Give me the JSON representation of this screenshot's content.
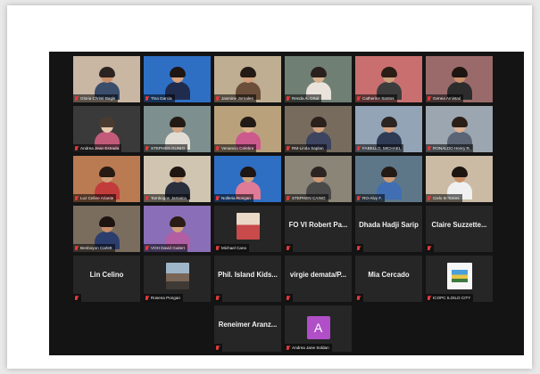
{
  "meeting": {
    "participants": [
      {
        "name": "Gloria Christi Bagis",
        "bg": "#c9b6a3",
        "skin": "#c98f6b",
        "hair": "#2b2320",
        "shirt": "#3a4d6b"
      },
      {
        "name": "Tina Garcia",
        "bg": "#2e6fc4",
        "skin": "#d9a37e",
        "hair": "#1d1613",
        "shirt": "#1f2c4e"
      },
      {
        "name": "Jasmine Jornales",
        "bg": "#bfae92",
        "skin": "#d2a07a",
        "hair": "#241a15",
        "shirt": "#6b4f3b"
      },
      {
        "name": "Renda A. Ortal",
        "bg": "#6f7f73",
        "skin": "#d8b18f",
        "hair": "#2a201b",
        "shirt": "#e9e3dc"
      },
      {
        "name": "Catherine Santos",
        "bg": "#c96f6f",
        "skin": "#caa07d",
        "hair": "#2a1d16",
        "shirt": "#3c3c3c"
      },
      {
        "name": "Genea Amistad",
        "bg": "#9a6a6a",
        "skin": "#c88f6a",
        "hair": "#1e1510",
        "shirt": "#2c2c2c"
      },
      {
        "name": "Andrea Jean Estrada",
        "bg": "#3a3a3a",
        "skin": "#e6c8ae",
        "hair": "#4a3b30",
        "shirt": "#c25b7a"
      },
      {
        "name": "STEPHEN GUNIO",
        "bg": "#7d8f8e",
        "skin": "#d4a583",
        "hair": "#231a14",
        "shirt": "#e1dcd3"
      },
      {
        "name": "Venancio Celebre",
        "bg": "#b9a27b",
        "skin": "#d8b08b",
        "hair": "#221a14",
        "shirt": "#cd5a8d"
      },
      {
        "name": "RM-Linda Saplan",
        "bg": "#766b5d",
        "skin": "#cfa17e",
        "hair": "#2b201a",
        "shirt": "#3d4460"
      },
      {
        "name": "FABELLO, MICHAEL",
        "bg": "#93a4b7",
        "skin": "#d5a280",
        "hair": "#2c2420",
        "shirt": "#2f3a55"
      },
      {
        "name": "RONALDO Henry R.",
        "bg": "#9ca6b0",
        "skin": "#dbb095",
        "hair": "#2a1e17",
        "shirt": "#5a6474"
      },
      {
        "name": "Luz Celine Ariante",
        "bg": "#ba7a52",
        "skin": "#d09e7a",
        "hair": "#261a13",
        "shirt": "#c23c3c"
      },
      {
        "name": "Tambogon Jamaica",
        "bg": "#d0c5b0",
        "skin": "#cf9d77",
        "hair": "#1f1611",
        "shirt": "#2a2f3e"
      },
      {
        "name": "Nolleria Rongan",
        "bg": "#2e6fc4",
        "skin": "#caa07d",
        "hair": "#1d1613",
        "shirt": "#e07b97"
      },
      {
        "name": "STEPHEN CAINO",
        "bg": "#8a8577",
        "skin": "#cc9976",
        "hair": "#2c2420",
        "shirt": "#4a4a4a"
      },
      {
        "name": "RO-Alvy F.",
        "bg": "#5d7789",
        "skin": "#c99a76",
        "hair": "#241a15",
        "shirt": "#3f6eb3"
      },
      {
        "name": "Cielo III Torres",
        "bg": "#cbbba4",
        "skin": "#c98f6b",
        "hair": "#1c1410",
        "shirt": "#f0f0f0"
      },
      {
        "name": "Benboyon Carlett",
        "bg": "#7b6d5e",
        "skin": "#c58d68",
        "hair": "#1d1410",
        "shirt": "#2c3e6e"
      },
      {
        "name": "VOH David Guiterr",
        "bg": "#8a6fb8",
        "skin": "#d2a07a",
        "hair": "#2a1d16",
        "shirt": "#b15ea3"
      },
      {
        "name": "Michael Cano",
        "bg": "#262626",
        "skin": "#d2a07a",
        "hair": "#2a1d16",
        "shirt": "#c43e3e"
      },
      {
        "name": "FO VI Robert Pa..."
      },
      {
        "name": "Dhada Hadji Sarip"
      },
      {
        "name": "Claire  Suzzette..."
      },
      {
        "name": "Lin Celino"
      },
      {
        "name": "Rosena Pongan"
      },
      {
        "name": "Phil. Island  Kids..."
      },
      {
        "name": "virgie  demata/P..."
      },
      {
        "name": "Mia Cercado"
      },
      {
        "name": "ICOPC ILOILO CITY"
      },
      {
        "name": "Reneimer  Aranz..."
      },
      {
        "name": "Andrea Jane Soldan",
        "initial": "A"
      }
    ]
  },
  "colors": {
    "window_bg": "#141414",
    "tile_bg": "#262626",
    "active_speaker": "#f3e24a",
    "muted_icon": "#e23a3a",
    "avatar_bg": "#b04fc8"
  }
}
